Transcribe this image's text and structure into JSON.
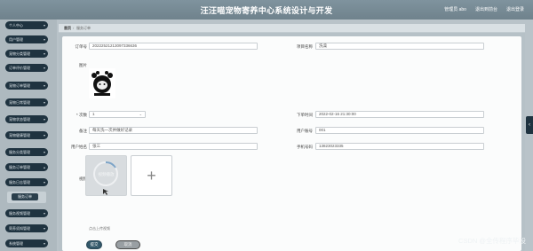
{
  "header": {
    "title": "汪汪喵宠物寄养中心系统设计与开发",
    "user_label": "管理员 abo",
    "link_front": "退出到前台",
    "link_logout": "退出登录"
  },
  "sidebar": {
    "items": [
      {
        "label": "个人中心"
      },
      {
        "label": "用户管理"
      },
      {
        "label": "宠物分类管理"
      },
      {
        "label": "订单评价管理"
      },
      {
        "label": "宠物订单管理"
      },
      {
        "label": "宠物日常管理"
      },
      {
        "label": "宠物状态管理"
      },
      {
        "label": "宠物健康管理"
      },
      {
        "label": "服务分类管理"
      },
      {
        "label": "服务订单管理"
      },
      {
        "label": "服务日志管理"
      }
    ],
    "sub_item": "服务订单",
    "items_after": [
      {
        "label": "服务视频管理"
      },
      {
        "label": "寄养须知管理"
      },
      {
        "label": "系统管理"
      }
    ]
  },
  "breadcrumb": {
    "home": "首页",
    "sep": "/",
    "current": "服务订单"
  },
  "form": {
    "order_no": {
      "label": "订单号",
      "value": "20222521213097336636"
    },
    "service_name": {
      "label": "项目名称",
      "value": "洗澡"
    },
    "picture": {
      "label": "图片"
    },
    "count": {
      "label": "* 次数",
      "value": "1"
    },
    "order_time": {
      "label": "下单时间",
      "value": "2022-02-16 21:30:00"
    },
    "remark": {
      "label": "备注",
      "value": "每天洗一次并做好记录"
    },
    "user_account": {
      "label": "用户账号",
      "value": "001"
    },
    "user_name": {
      "label": "用户姓名",
      "value": "张三"
    },
    "phone": {
      "label": "手机号码",
      "value": "13823023335"
    },
    "video": {
      "label": "视频",
      "hint": "点击上传视频",
      "play_label": "视频播放"
    }
  },
  "buttons": {
    "submit": "提交",
    "cancel": "取消"
  },
  "watermark": "CSDN @全传程序毕设",
  "colors": {
    "header": "#778a94",
    "sidebar_item": "#1f3340",
    "primary_button": "#33586a"
  }
}
